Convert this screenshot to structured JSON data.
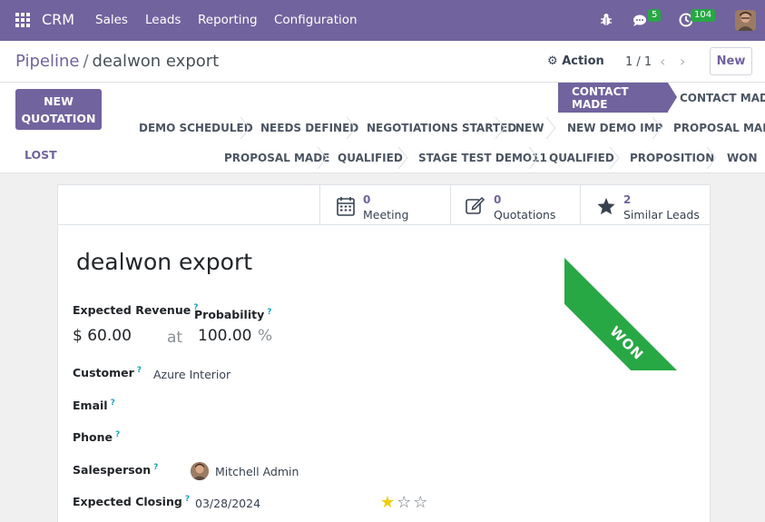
{
  "navbar": {
    "brand": "CRM",
    "menu": [
      "Sales",
      "Leads",
      "Reporting",
      "Configuration"
    ],
    "chat_badge": "5",
    "activity_badge": "104"
  },
  "control": {
    "breadcrumb_parent": "Pipeline",
    "breadcrumb_sep": "/",
    "breadcrumb_current": "dealwon export",
    "action_label": "Action",
    "pager": "1 / 1",
    "new_label": "New"
  },
  "statusbar": {
    "new_quotation_line1": "NEW",
    "new_quotation_line2": "QUOTATION",
    "lost_label": "LOST",
    "active_stage": "CONTACT MADE",
    "row1": [
      "CONTACT MADE"
    ],
    "row2": [
      "DEMO SCHEDULED",
      "NEEDS DEFINED",
      "NEGOTIATIONS STARTED",
      "NEW",
      "NEW DEMO IMP",
      "PROPOSAL MADE"
    ],
    "row3": [
      "PROPOSAL MADE",
      "QUALIFIED",
      "STAGE TEST DEMO11",
      "QUALIFIED",
      "PROPOSITION",
      "WON"
    ]
  },
  "smart_buttons": [
    {
      "count": "0",
      "label": "Meeting",
      "icon": "calendar-icon"
    },
    {
      "count": "0",
      "label": "Quotations",
      "icon": "edit-icon"
    },
    {
      "count": "2",
      "label": "Similar Leads",
      "icon": "star-icon"
    }
  ],
  "ribbon": "WON",
  "form": {
    "title": "dealwon export",
    "expected_revenue_label": "Expected Revenue",
    "expected_revenue": "$ 60.00",
    "at": "at",
    "probability_label": "Probability",
    "probability": "100.00",
    "percent": "%",
    "customer_label": "Customer",
    "customer": "Azure Interior",
    "email_label": "Email",
    "phone_label": "Phone",
    "salesperson_label": "Salesperson",
    "salesperson": "Mitchell Admin",
    "expected_closing_label": "Expected Closing",
    "expected_closing": "03/28/2024",
    "help_mark": "?",
    "priority": 1
  },
  "colors": {
    "brand": "#71639e",
    "won": "#28a745",
    "star": "#f3cc00"
  }
}
